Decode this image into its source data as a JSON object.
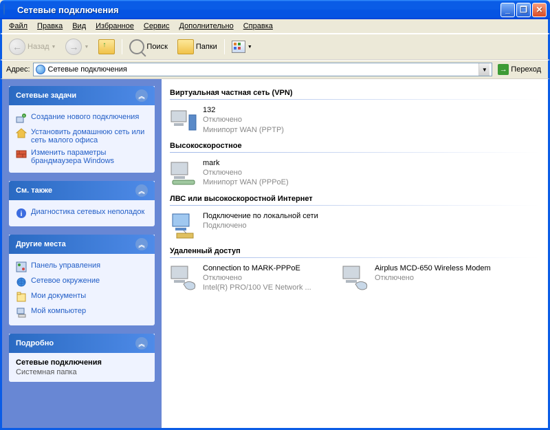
{
  "window": {
    "title": "Сетевые подключения"
  },
  "menu": {
    "file": "Файл",
    "edit": "Правка",
    "view": "Вид",
    "favorites": "Избранное",
    "service": "Сервис",
    "extra": "Дополнительно",
    "help": "Справка"
  },
  "toolbar": {
    "back": "Назад",
    "search": "Поиск",
    "folders": "Папки"
  },
  "address": {
    "label": "Адрес:",
    "value": "Сетевые подключения",
    "go": "Переход"
  },
  "sidebar": {
    "tasks": {
      "title": "Сетевые задачи",
      "items": [
        {
          "label": "Создание нового подключения"
        },
        {
          "label": "Установить домашнюю сеть или сеть малого офиса"
        },
        {
          "label": "Изменить параметры брандмаузера Windows"
        }
      ]
    },
    "seealso": {
      "title": "См. также",
      "items": [
        {
          "label": "Диагностика сетевых неполадок"
        }
      ]
    },
    "places": {
      "title": "Другие места",
      "items": [
        {
          "label": "Панель управления"
        },
        {
          "label": "Сетевое окружение"
        },
        {
          "label": "Мои документы"
        },
        {
          "label": "Мой компьютер"
        }
      ]
    },
    "details": {
      "title": "Подробно",
      "name": "Сетевые подключения",
      "type": "Системная папка"
    }
  },
  "main": {
    "groups": [
      {
        "title": "Виртуальная частная сеть (VPN)",
        "items": [
          {
            "name": "132",
            "status": "Отключено",
            "device": "Минипорт WAN (PPTP)"
          }
        ]
      },
      {
        "title": "Высокоскоростное",
        "items": [
          {
            "name": "mark",
            "status": "Отключено",
            "device": "Минипорт WAN (PPPoE)"
          }
        ]
      },
      {
        "title": "ЛВС или высокоскоростной Интернет",
        "items": [
          {
            "name": "Подключение по локальной сети",
            "status": "Подключено",
            "device": ""
          }
        ]
      },
      {
        "title": "Удаленный доступ",
        "items": [
          {
            "name": "Connection to MARK-PPPoE",
            "status": "Отключено",
            "device": "Intel(R) PRO/100 VE Network ..."
          },
          {
            "name": "Airplus MCD-650 Wireless Modem",
            "status": "Отключено",
            "device": ""
          }
        ]
      }
    ]
  }
}
